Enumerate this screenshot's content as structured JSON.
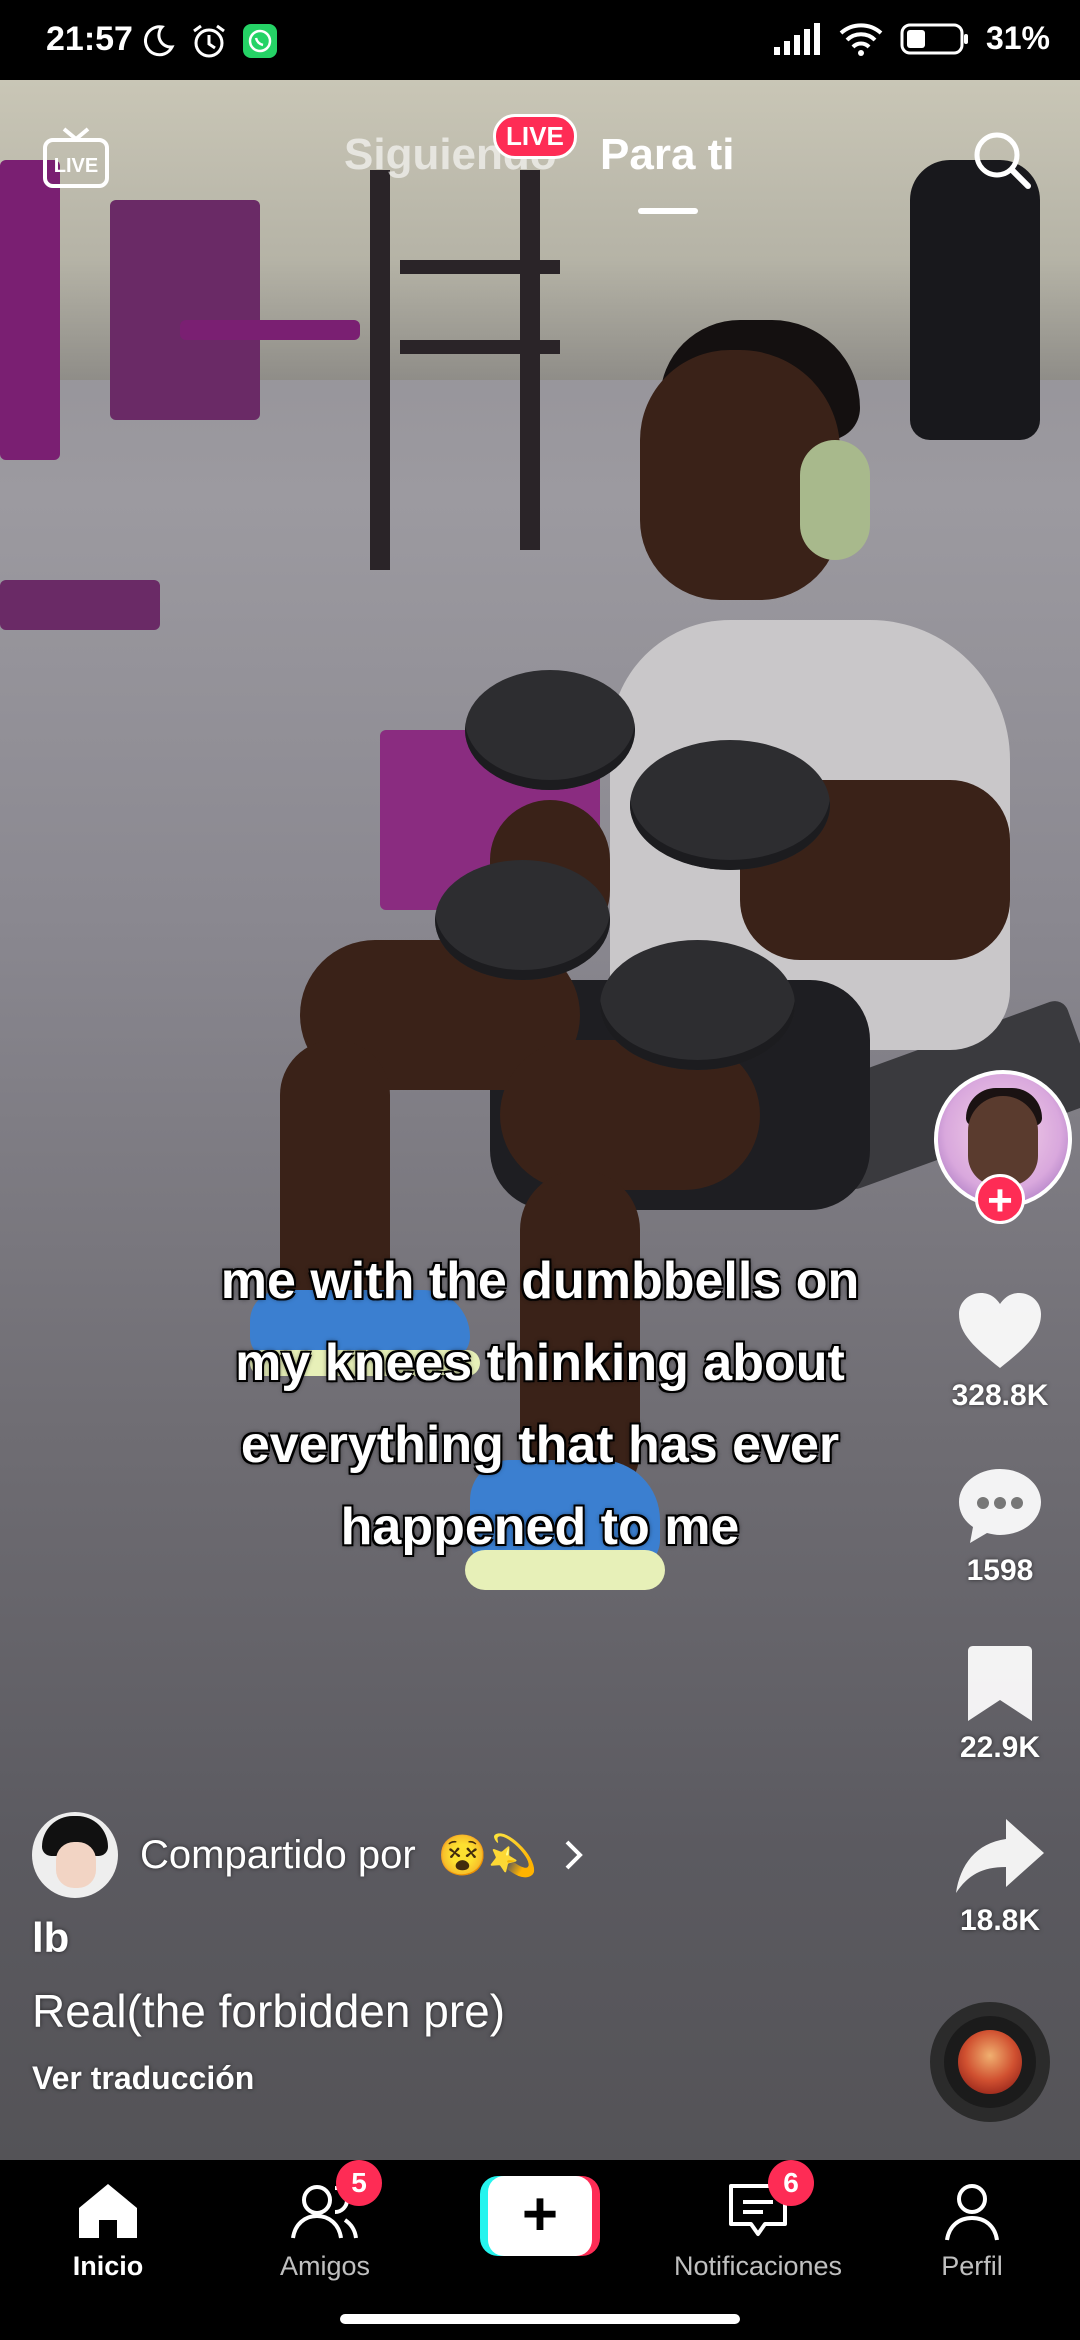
{
  "status_bar": {
    "time": "21:57",
    "battery_percent": "31%",
    "icons": [
      "moon-icon",
      "alarm-icon",
      "whatsapp-icon",
      "signal-icon",
      "wifi-icon",
      "battery-icon"
    ]
  },
  "top_nav": {
    "live_icon_label": "LIVE",
    "tab_following": "Siguiendo",
    "live_badge": "LIVE",
    "tab_for_you": "Para ti",
    "active_tab": "Para ti"
  },
  "video": {
    "caption_line1": "me with the dumbbells on",
    "caption_line2": "my knees thinking about",
    "caption_line3": "everything that has ever",
    "caption_line4": "happened to me"
  },
  "rail": {
    "likes": "328.8K",
    "comments": "1598",
    "saves": "22.9K",
    "shares": "18.8K"
  },
  "info": {
    "shared_by": "Compartido por",
    "shared_emoji": "😵💫",
    "username": "lb",
    "description": "Real(the forbidden pre)",
    "translate": "Ver traducción"
  },
  "bottom_nav": {
    "home": "Inicio",
    "friends": "Amigos",
    "friends_badge": "5",
    "inbox": "Notificaciones",
    "inbox_badge": "6",
    "profile": "Perfil",
    "create": "+"
  },
  "colors": {
    "accent_red": "#fe2c55",
    "accent_cyan": "#25f4ee"
  }
}
